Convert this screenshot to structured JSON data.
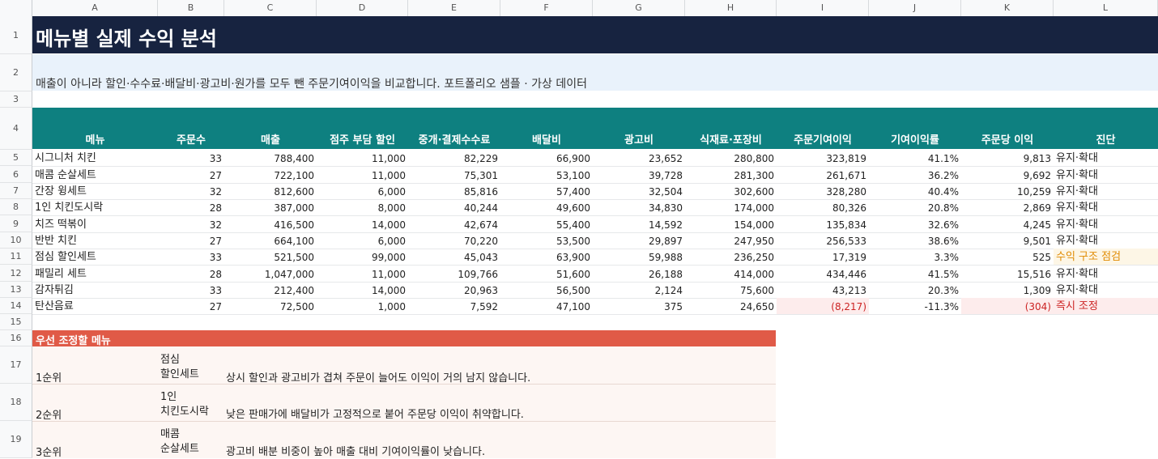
{
  "columns": [
    "A",
    "B",
    "C",
    "D",
    "E",
    "F",
    "G",
    "H",
    "I",
    "J",
    "K",
    "L"
  ],
  "rows": [
    "1",
    "2",
    "3",
    "4",
    "5",
    "6",
    "7",
    "8",
    "9",
    "10",
    "11",
    "12",
    "13",
    "14",
    "15",
    "16",
    "17",
    "18",
    "19"
  ],
  "title": "메뉴별 실제 수익 분석",
  "subtitle": "매출이 아니라 할인·수수료·배달비·광고비·원가를 모두 뺀 주문기여이익을 비교합니다. 포트폴리오 샘플 · 가상 데이터",
  "headers": [
    "메뉴",
    "주문수",
    "매출",
    "점주 부담 할인",
    "중개·결제수수료",
    "배달비",
    "광고비",
    "식재료·포장비",
    "주문기여이익",
    "기여이익률",
    "주문당 이익",
    "진단"
  ],
  "table": [
    [
      "시그니처 치킨",
      "33",
      "788,400",
      "11,000",
      "82,229",
      "66,900",
      "23,652",
      "280,800",
      "323,819",
      "41.1%",
      "9,813",
      "유지·확대"
    ],
    [
      "매콤 순살세트",
      "27",
      "722,100",
      "11,000",
      "75,301",
      "53,100",
      "39,728",
      "281,300",
      "261,671",
      "36.2%",
      "9,692",
      "유지·확대"
    ],
    [
      "간장 윙세트",
      "32",
      "812,600",
      "6,000",
      "85,816",
      "57,400",
      "32,504",
      "302,600",
      "328,280",
      "40.4%",
      "10,259",
      "유지·확대"
    ],
    [
      "1인 치킨도시락",
      "28",
      "387,000",
      "8,000",
      "40,244",
      "49,600",
      "34,830",
      "174,000",
      "80,326",
      "20.8%",
      "2,869",
      "유지·확대"
    ],
    [
      "치즈 떡볶이",
      "32",
      "416,500",
      "14,000",
      "42,674",
      "55,400",
      "14,592",
      "154,000",
      "135,834",
      "32.6%",
      "4,245",
      "유지·확대"
    ],
    [
      "반반 치킨",
      "27",
      "664,100",
      "6,000",
      "70,220",
      "53,500",
      "29,897",
      "247,950",
      "256,533",
      "38.6%",
      "9,501",
      "유지·확대"
    ],
    [
      "점심 할인세트",
      "33",
      "521,500",
      "99,000",
      "45,043",
      "63,900",
      "59,988",
      "236,250",
      "17,319",
      "3.3%",
      "525",
      "수익 구조 점검"
    ],
    [
      "패밀리 세트",
      "28",
      "1,047,000",
      "11,000",
      "109,766",
      "51,600",
      "26,188",
      "414,000",
      "434,446",
      "41.5%",
      "15,516",
      "유지·확대"
    ],
    [
      "감자튀김",
      "33",
      "212,400",
      "14,000",
      "20,963",
      "56,500",
      "2,124",
      "75,600",
      "43,213",
      "20.3%",
      "1,309",
      "유지·확대"
    ],
    [
      "탄산음료",
      "27",
      "72,500",
      "1,000",
      "7,592",
      "47,100",
      "375",
      "24,650",
      "(8,217)",
      "-11.3%",
      "(304)",
      "즉시 조정"
    ]
  ],
  "section_title": "우선 조정할 메뉴",
  "priorities": [
    {
      "rank": "1순위",
      "menu_line1": "점심",
      "menu_line2": "할인세트",
      "desc": "상시 할인과 광고비가 겹쳐 주문이 늘어도 이익이 거의 남지 않습니다."
    },
    {
      "rank": "2순위",
      "menu_line1": "1인",
      "menu_line2": "치킨도시락",
      "desc": "낮은 판매가에 배달비가 고정적으로 붙어 주문당 이익이 취약합니다."
    },
    {
      "rank": "3순위",
      "menu_line1": "매콤",
      "menu_line2": "순살세트",
      "desc": "광고비 배분 비중이 높아 매출 대비 기여이익률이 낮습니다."
    }
  ],
  "colors": {
    "title_bg": "#172340",
    "header_bg": "#0e8080",
    "section_bg": "#e05a47",
    "negative": "#cc2222",
    "warning": "#e08a00"
  }
}
